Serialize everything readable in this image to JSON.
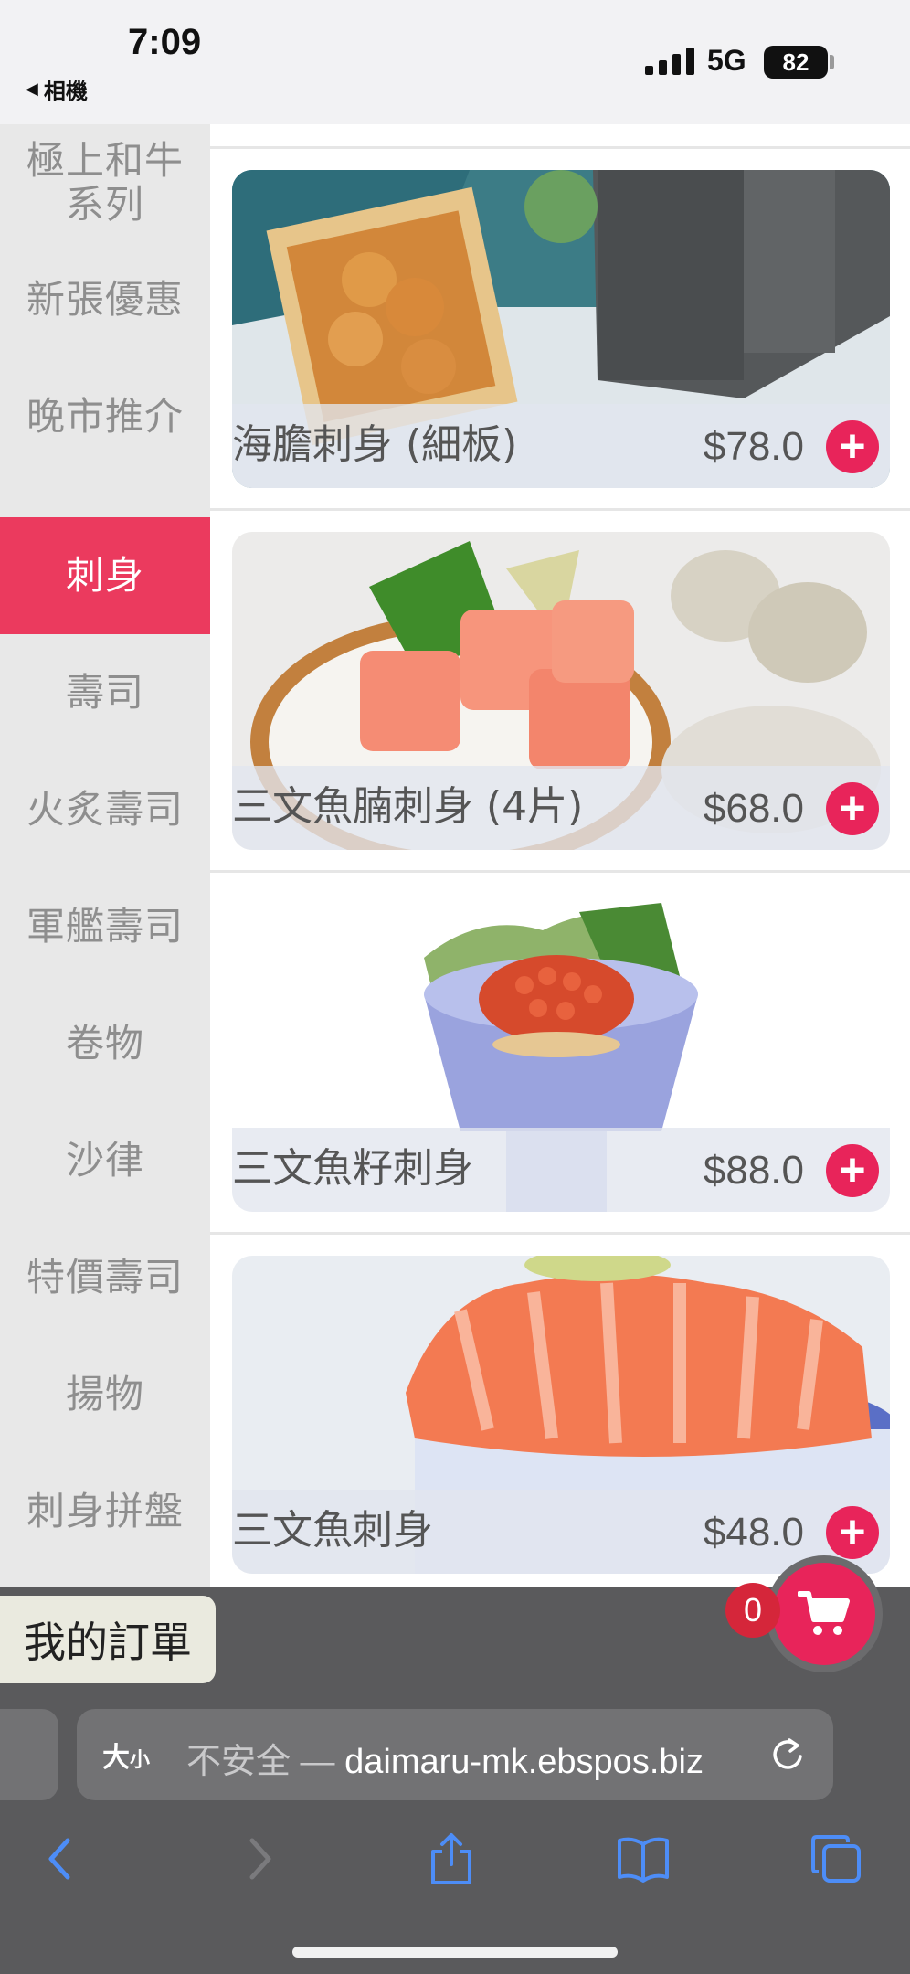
{
  "status_bar": {
    "time": "7:09",
    "back_app": "相機",
    "network": "5G",
    "battery": "82"
  },
  "sidebar": {
    "categories": [
      "極上和牛系列",
      "新張優惠",
      "晚市推介",
      "刺身",
      "壽司",
      "火炙壽司",
      "軍艦壽司",
      "卷物",
      "沙律",
      "特價壽司",
      "揚物",
      "刺身拼盤"
    ],
    "active_index": 3,
    "colors": {
      "active_bg": "#eb3a5e",
      "text": "#8e8e8e"
    }
  },
  "menu_items": [
    {
      "name": "海膽刺身 (細板)",
      "price": "$78.0",
      "image": "sea-urchin-sashimi-photo"
    },
    {
      "name": "三文魚腩刺身 (4片)",
      "price": "$68.0",
      "image": "salmon-belly-sashimi-photo"
    },
    {
      "name": "三文魚籽刺身",
      "price": "$88.0",
      "image": "salmon-roe-sashimi-photo"
    },
    {
      "name": "三文魚刺身",
      "price": "$48.0",
      "image": "salmon-sashimi-photo"
    }
  ],
  "order_bar": {
    "my_order_label": "我的訂單",
    "cart_count": "0",
    "accent": "#e8245a"
  },
  "browser": {
    "text_size_big": "大",
    "text_size_small": "小",
    "security_label": "不安全 —",
    "domain": "daimaru-mk.ebspos.biz"
  }
}
